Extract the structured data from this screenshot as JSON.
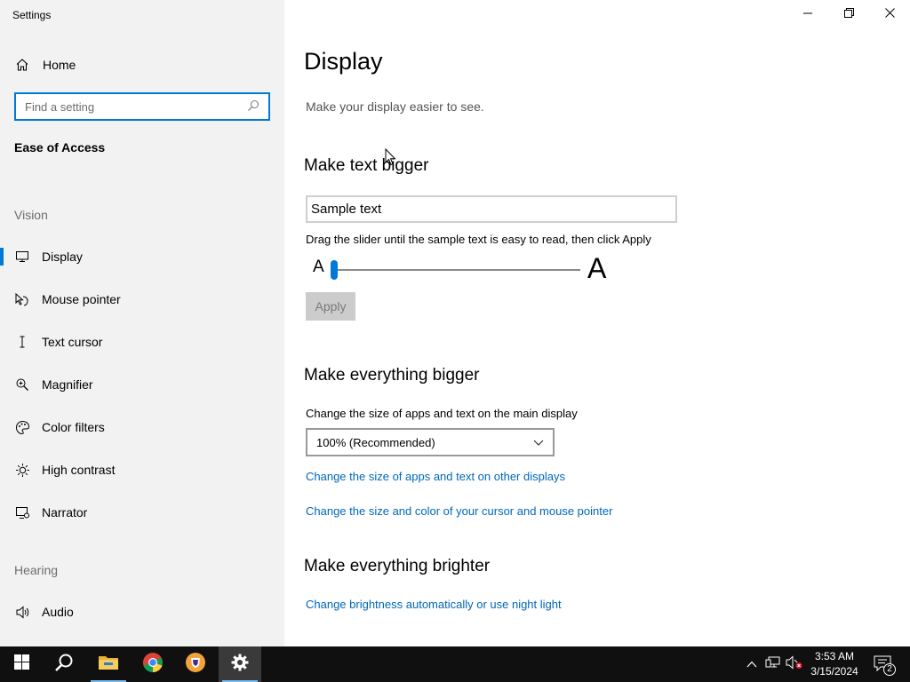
{
  "window": {
    "title": "Settings",
    "controls": [
      "minimize",
      "restore",
      "close"
    ]
  },
  "sidebar": {
    "home_label": "Home",
    "search_placeholder": "Find a setting",
    "category": "Ease of Access",
    "groups": {
      "vision": "Vision",
      "hearing": "Hearing"
    },
    "items": [
      {
        "label": "Display",
        "icon": "monitor-icon",
        "active": true
      },
      {
        "label": "Mouse pointer",
        "icon": "mouse-pointer-icon"
      },
      {
        "label": "Text cursor",
        "icon": "text-cursor-icon"
      },
      {
        "label": "Magnifier",
        "icon": "magnifier-icon"
      },
      {
        "label": "Color filters",
        "icon": "palette-icon"
      },
      {
        "label": "High contrast",
        "icon": "sun-icon"
      },
      {
        "label": "Narrator",
        "icon": "narrator-icon"
      },
      {
        "label": "Audio",
        "icon": "speaker-icon"
      }
    ]
  },
  "main": {
    "title": "Display",
    "description": "Make your display easier to see.",
    "text_bigger": {
      "heading": "Make text bigger",
      "sample_text": "Sample text",
      "hint": "Drag the slider until the sample text is easy to read, then click Apply",
      "small_label": "A",
      "big_label": "A",
      "slider_value_percent": 100,
      "apply_label": "Apply"
    },
    "everything_bigger": {
      "heading": "Make everything bigger",
      "field_label": "Change the size of apps and text on the main display",
      "selected_scale": "100% (Recommended)",
      "link_other_displays": "Change the size of apps and text on other displays",
      "link_cursor": "Change the size and color of your cursor and mouse pointer"
    },
    "everything_brighter": {
      "heading": "Make everything brighter",
      "link_brightness": "Change brightness automatically or use night light"
    }
  },
  "taskbar": {
    "apps": [
      "start",
      "search",
      "file-explorer",
      "chrome",
      "brave",
      "settings"
    ],
    "time": "3:53 AM",
    "date": "3/15/2024",
    "notification_count": "2"
  },
  "colors": {
    "accent": "#0078d7",
    "link": "#0067b8",
    "sidebar_bg": "#f2f2f2",
    "taskbar_bg": "#101010"
  }
}
